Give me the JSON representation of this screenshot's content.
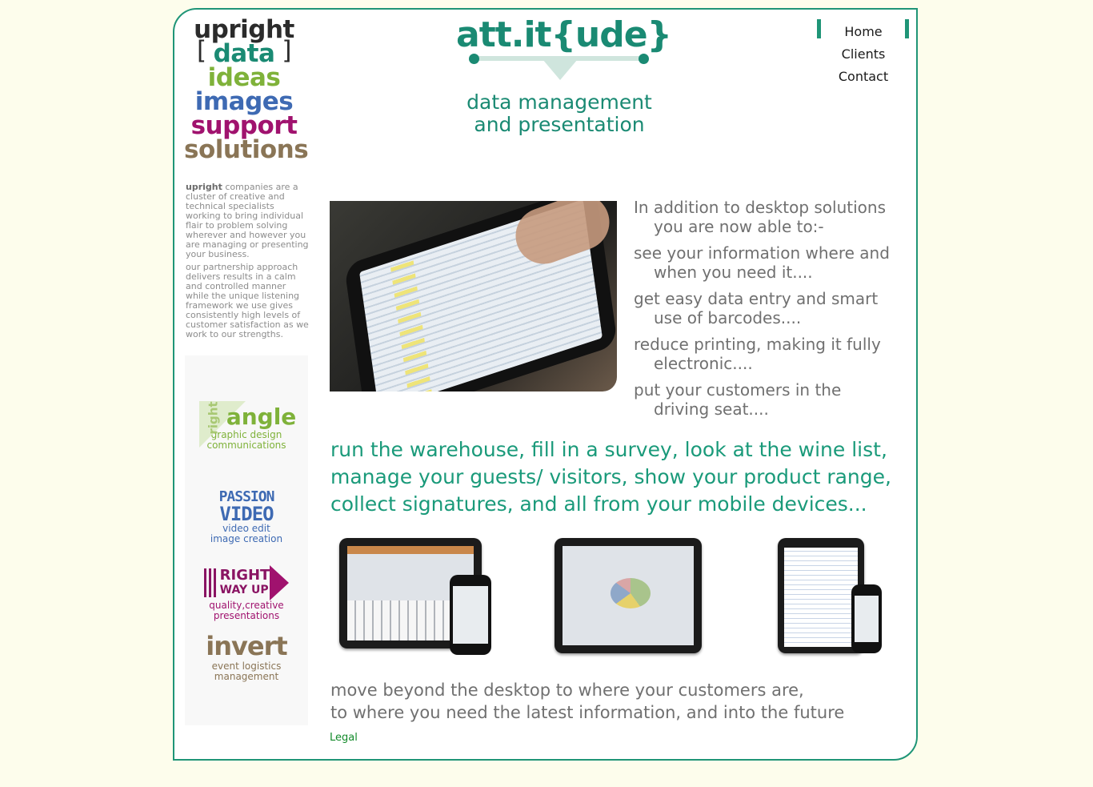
{
  "brand": {
    "words": [
      "upright",
      "data",
      "ideas",
      "images",
      "support",
      "solutions"
    ]
  },
  "about": {
    "lead": "upright",
    "para1": " companies are a cluster of creative and technical specialists working to bring individual flair to problem solving wherever and however you are managing or presenting your business.",
    "para2": "our partnership approach delivers results in a calm and controlled manner while the unique listening framework we use gives consistently high levels of customer satisfaction as we work to our strengths."
  },
  "partners": [
    {
      "logo_top": "right",
      "logo_main": "angle",
      "caption1": "graphic design",
      "caption2": "communications"
    },
    {
      "logo_line1": "PASSION",
      "logo_line2": "VIDEO",
      "caption1": "video edit",
      "caption2": "image creation"
    },
    {
      "logo_line1": "RIGHT",
      "logo_line2": "WAY UP",
      "caption1": "quality,creative",
      "caption2": "presentations"
    },
    {
      "logo_main": "invert",
      "caption1": "event logistics",
      "caption2": "management"
    }
  ],
  "logo": {
    "title": "att.it{ude}",
    "tagline1": "data management",
    "tagline2": "and presentation"
  },
  "nav": [
    "Home",
    "Clients",
    "Contact"
  ],
  "intro": [
    "In addition to desktop solutions you are now able to:-",
    "see your information where and when you need it....",
    "get easy data entry and smart use of barcodes....",
    "reduce printing, making it fully electronic....",
    "put your customers in the driving seat...."
  ],
  "runline": {
    "line1": "run the warehouse, fill in a survey, look at the wine list,",
    "line2": "manage your guests/ visitors, show your product range,",
    "line3": "collect signatures, and all from your mobile devices..."
  },
  "closing": {
    "line1": "move beyond the desktop to where your customers are,",
    "line2": "to where you need the latest information, and into the future"
  },
  "footer": {
    "legal": "Legal"
  }
}
